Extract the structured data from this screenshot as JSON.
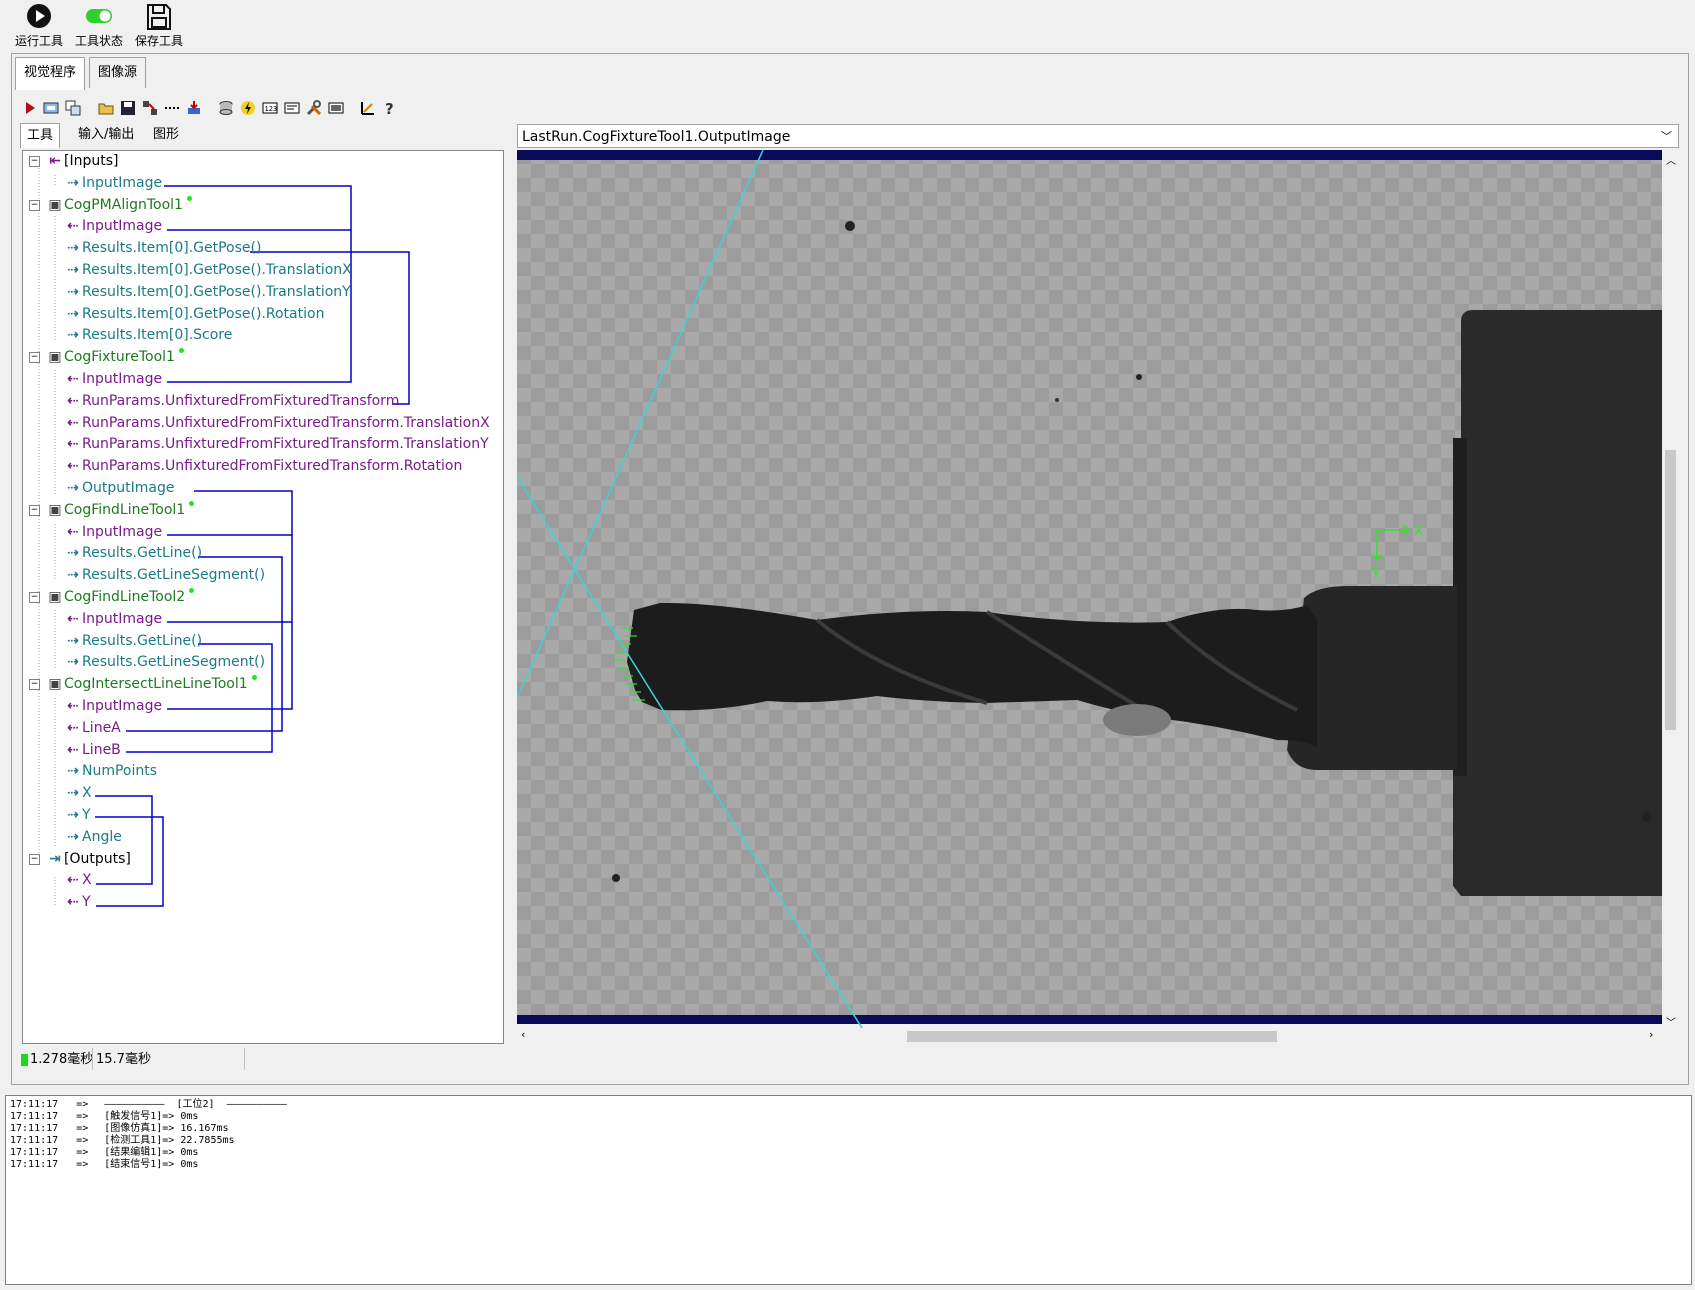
{
  "toolbar": {
    "run_label": "运行工具",
    "status_label": "工具状态",
    "save_label": "保存工具"
  },
  "main_tabs": [
    "视觉程序",
    "图像源"
  ],
  "sub_tabs": [
    "工具",
    "输入/输出",
    "图形"
  ],
  "tree": [
    {
      "text": "[Inputs]",
      "kind": "blk"
    },
    {
      "text": "InputImage",
      "kind": "out"
    },
    {
      "text": "CogPMAlignTool1",
      "kind": "tool"
    },
    {
      "text": "InputImage",
      "kind": "in"
    },
    {
      "text": "Results.Item[0].GetPose()",
      "kind": "out"
    },
    {
      "text": "Results.Item[0].GetPose().TranslationX",
      "kind": "out"
    },
    {
      "text": "Results.Item[0].GetPose().TranslationY",
      "kind": "out"
    },
    {
      "text": "Results.Item[0].GetPose().Rotation",
      "kind": "out"
    },
    {
      "text": "Results.Item[0].Score",
      "kind": "out"
    },
    {
      "text": "CogFixtureTool1",
      "kind": "tool"
    },
    {
      "text": "InputImage",
      "kind": "in"
    },
    {
      "text": "RunParams.UnfixturedFromFixturedTransform",
      "kind": "in"
    },
    {
      "text": "RunParams.UnfixturedFromFixturedTransform.TranslationX",
      "kind": "in"
    },
    {
      "text": "RunParams.UnfixturedFromFixturedTransform.TranslationY",
      "kind": "in"
    },
    {
      "text": "RunParams.UnfixturedFromFixturedTransform.Rotation",
      "kind": "in"
    },
    {
      "text": "OutputImage",
      "kind": "out"
    },
    {
      "text": "CogFindLineTool1",
      "kind": "tool"
    },
    {
      "text": "InputImage",
      "kind": "in"
    },
    {
      "text": "Results.GetLine()",
      "kind": "out"
    },
    {
      "text": "Results.GetLineSegment()",
      "kind": "out"
    },
    {
      "text": "CogFindLineTool2",
      "kind": "tool"
    },
    {
      "text": "InputImage",
      "kind": "in"
    },
    {
      "text": "Results.GetLine()",
      "kind": "out"
    },
    {
      "text": "Results.GetLineSegment()",
      "kind": "out"
    },
    {
      "text": "CogIntersectLineLineTool1",
      "kind": "tool"
    },
    {
      "text": "InputImage",
      "kind": "in"
    },
    {
      "text": "LineA",
      "kind": "in"
    },
    {
      "text": "LineB",
      "kind": "in"
    },
    {
      "text": "NumPoints",
      "kind": "out"
    },
    {
      "text": "X",
      "kind": "out"
    },
    {
      "text": "Y",
      "kind": "out"
    },
    {
      "text": "Angle",
      "kind": "out"
    },
    {
      "text": "[Outputs]",
      "kind": "blk"
    },
    {
      "text": "X",
      "kind": "in"
    },
    {
      "text": "Y",
      "kind": "in"
    }
  ],
  "image_panel": {
    "selector_value": "LastRun.CogFixtureTool1.OutputImage",
    "axis_x_label": "X",
    "axis_y_label": "Y"
  },
  "status": {
    "time1": "1.278毫秒",
    "time2": "15.7毫秒"
  },
  "log": [
    {
      "time": "17:11:17",
      "arrow": "=>",
      "msg": "——————————  [工位2]  ——————————"
    },
    {
      "time": "17:11:17",
      "arrow": "=>",
      "msg": "[触发信号1]=> 0ms"
    },
    {
      "time": "17:11:17",
      "arrow": "=>",
      "msg": "[图像仿真1]=> 16.167ms"
    },
    {
      "time": "17:11:17",
      "arrow": "=>",
      "msg": "[检测工具1]=> 22.7855ms"
    },
    {
      "time": "17:11:17",
      "arrow": "=>",
      "msg": "[结果编辑1]=> 0ms"
    },
    {
      "time": "17:11:17",
      "arrow": "=>",
      "msg": "[结束信号1]=> 0ms"
    }
  ],
  "colors": {
    "input_link": "#7a1a8a",
    "output_link": "#1b7a85",
    "tool": "#1e7a1e",
    "connector": "#0000cc",
    "fit_line": "#3cd3d3",
    "image_border": "#0a0a5a"
  }
}
